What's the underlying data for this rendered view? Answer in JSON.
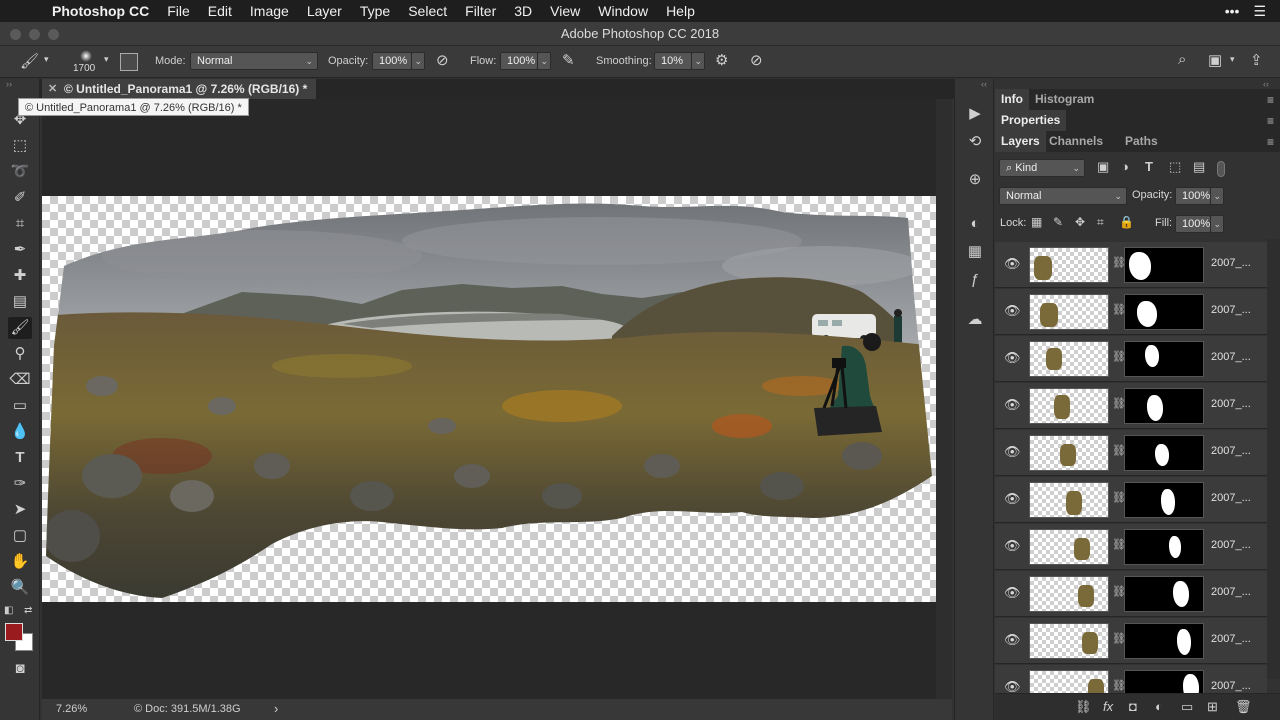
{
  "menubar": {
    "app": "Photoshop CC",
    "items": [
      "File",
      "Edit",
      "Image",
      "Layer",
      "Type",
      "Select",
      "Filter",
      "3D",
      "View",
      "Window",
      "Help"
    ]
  },
  "window_title": "Adobe Photoshop CC 2018",
  "options": {
    "brush_size": "1700",
    "mode_label": "Mode:",
    "mode_value": "Normal",
    "opacity_label": "Opacity:",
    "opacity_value": "100%",
    "flow_label": "Flow:",
    "flow_value": "100%",
    "smoothing_label": "Smoothing:",
    "smoothing_value": "10%"
  },
  "document": {
    "tab_label": "© Untitled_Panorama1 @ 7.26% (RGB/16) *",
    "tooltip": "© Untitled_Panorama1 @ 7.26% (RGB/16) *"
  },
  "status": {
    "zoom": "7.26%",
    "doc_info": "© Doc: 391.5M/1.38G"
  },
  "panels": {
    "group1_tabs": [
      "Info",
      "Histogram"
    ],
    "group2_tabs": [
      "Properties"
    ],
    "group3_tabs": [
      "Layers",
      "Channels",
      "Paths"
    ],
    "filter_kind": "Kind",
    "blend_mode": "Normal",
    "opacity_label": "Opacity:",
    "opacity_value": "100%",
    "lock_label": "Lock:",
    "fill_label": "Fill:",
    "fill_value": "100%"
  },
  "layers": [
    {
      "name": "2007_..."
    },
    {
      "name": "2007_..."
    },
    {
      "name": "2007_..."
    },
    {
      "name": "2007_..."
    },
    {
      "name": "2007_..."
    },
    {
      "name": "2007_..."
    },
    {
      "name": "2007_..."
    },
    {
      "name": "2007_..."
    },
    {
      "name": "2007_..."
    },
    {
      "name": "2007_..."
    }
  ],
  "colors": {
    "foreground": "#9a1b1e",
    "background": "#ffffff"
  }
}
